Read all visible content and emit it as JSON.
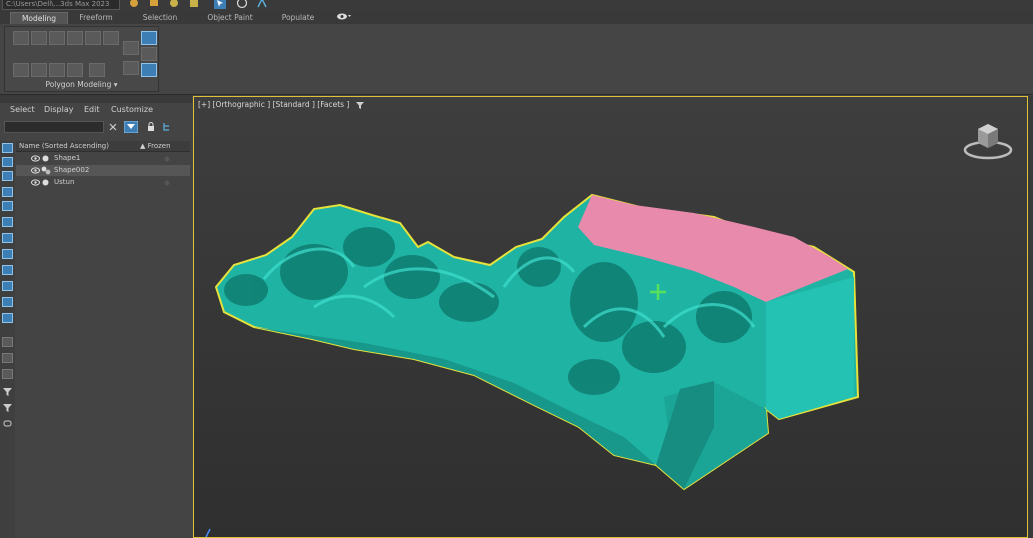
{
  "title_bar": {
    "project_field": "C:\\Users\\Dell\\...3ds Max 2023"
  },
  "ribbon": {
    "tabs": [
      {
        "label": "Modeling",
        "active": true
      },
      {
        "label": "Freeform",
        "active": false
      },
      {
        "label": "Selection",
        "active": false
      },
      {
        "label": "Object Paint",
        "active": false
      },
      {
        "label": "Populate",
        "active": false
      }
    ],
    "group_label": "Polygon Modeling ▾"
  },
  "scene_explorer": {
    "menu": [
      "Select",
      "Display",
      "Edit",
      "Customize"
    ],
    "columns": {
      "name": "Name (Sorted Ascending)",
      "frozen": "▲ Frozen"
    },
    "rows": [
      {
        "name": "Shape1",
        "selected": false
      },
      {
        "name": "Shape002",
        "selected": true
      },
      {
        "name": "Ustun",
        "selected": false
      }
    ]
  },
  "viewport": {
    "label": "[+] [Orthographic ] [Standard ] [Facets ]",
    "colors": {
      "mesh": "#1fb3a4",
      "mesh_dark": "#0f6f66",
      "cap": "#e88aac",
      "highlight": "#e6e23c",
      "border": "#e0c23a"
    }
  },
  "colors": {
    "accent": "#3d7fb5",
    "panel": "#444444",
    "ribbon": "#454545"
  }
}
